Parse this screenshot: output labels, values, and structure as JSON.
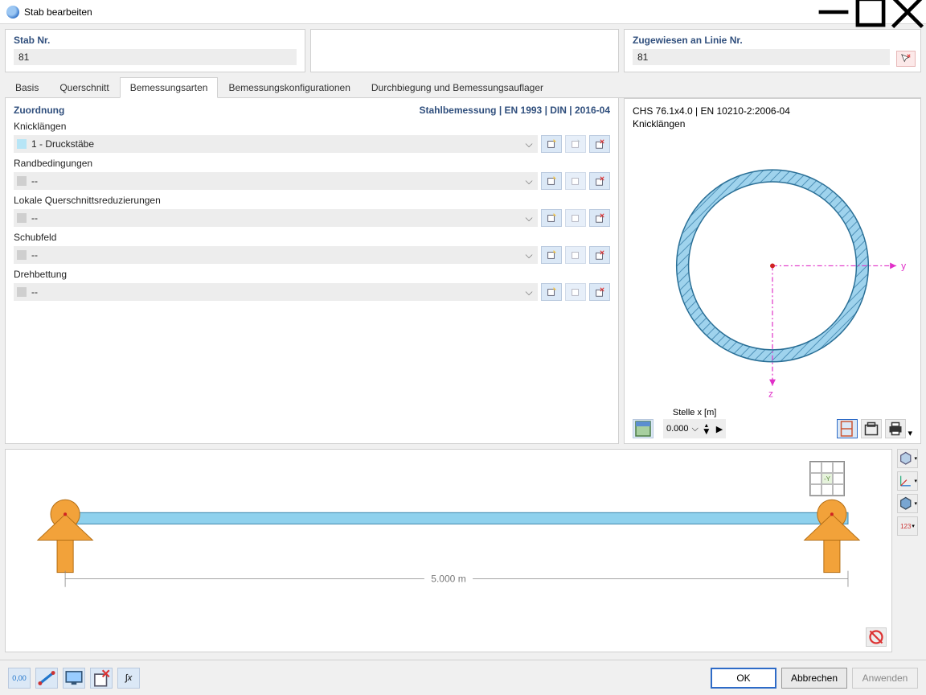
{
  "window": {
    "title": "Stab bearbeiten"
  },
  "hdr": {
    "stab_label": "Stab Nr.",
    "stab_value": "81",
    "line_label": "Zugewiesen an Linie Nr.",
    "line_value": "81"
  },
  "tabs": {
    "t0": "Basis",
    "t1": "Querschnitt",
    "t2": "Bemessungsarten",
    "t3": "Bemessungskonfigurationen",
    "t4": "Durchbiegung und Bemessungsauflager"
  },
  "zuord": {
    "title": "Zuordnung",
    "badge": "Stahlbemessung | EN 1993 | DIN | 2016-04"
  },
  "fields": {
    "knick_label": "Knicklängen",
    "knick_value": "1 - Druckstäbe",
    "rand_label": "Randbedingungen",
    "empty": "--",
    "lokal_label": "Lokale Querschnittsreduzierungen",
    "schub_label": "Schubfeld",
    "dreh_label": "Drehbettung"
  },
  "preview": {
    "h1": "CHS 76.1x4.0 | EN 10210-2:2006-04",
    "h2": "Knicklängen",
    "stelle_label": "Stelle x [m]",
    "stelle_value": "0.000",
    "axis_y": "y",
    "axis_z": "z"
  },
  "beam": {
    "length_label": "5.000 m"
  },
  "footer": {
    "ok": "OK",
    "cancel": "Abbrechen",
    "apply": "Anwenden"
  }
}
